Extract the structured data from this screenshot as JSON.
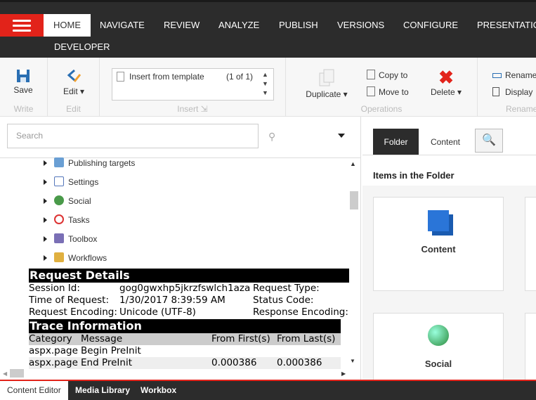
{
  "menu": {
    "tabs": [
      "HOME",
      "NAVIGATE",
      "REVIEW",
      "ANALYZE",
      "PUBLISH",
      "VERSIONS",
      "CONFIGURE",
      "PRESENTATION"
    ],
    "row2": [
      "DEVELOPER"
    ]
  },
  "ribbon": {
    "write": {
      "save": "Save",
      "label": "Write"
    },
    "edit": {
      "edit": "Edit",
      "label": "Edit"
    },
    "insert": {
      "item": "Insert from template",
      "count": "(1 of 1)",
      "label": "Insert"
    },
    "operations": {
      "duplicate": "Duplicate",
      "copy": "Copy to",
      "move": "Move to",
      "delete": "Delete",
      "label": "Operations"
    },
    "rename": {
      "rename": "Rename",
      "display": "Display",
      "label": "Rename"
    }
  },
  "search": {
    "placeholder": "Search"
  },
  "tree": [
    "Publishing targets",
    "Settings",
    "Social",
    "Tasks",
    "Toolbox",
    "Workflows"
  ],
  "trace": {
    "request_title": "Request Details",
    "rows": [
      [
        "Session Id:",
        "gog0gwxhp5jkrzfswlch1aza",
        "Request Type:"
      ],
      [
        "Time of Request:",
        "1/30/2017 8:39:59 AM",
        "Status Code:"
      ],
      [
        "Request Encoding:",
        "Unicode (UTF-8)",
        "Response Encoding:"
      ]
    ],
    "trace_title": "Trace Information",
    "columns": [
      "Category",
      "Message",
      "From First(s)",
      "From Last(s)"
    ],
    "entries": [
      [
        "aspx.page",
        "Begin PreInit",
        "",
        ""
      ],
      [
        "aspx.page",
        "End PreInit",
        "0.000386",
        "0.000386"
      ]
    ]
  },
  "right": {
    "tabs": [
      "Folder",
      "Content"
    ],
    "heading": "Items in the Folder",
    "cards": [
      "Content",
      "Social"
    ]
  },
  "bottom": {
    "tabs": [
      "Content Editor",
      "Media Library",
      "Workbox"
    ]
  },
  "colors": {
    "accent": "#e2231a",
    "dark": "#2c2c2c"
  }
}
